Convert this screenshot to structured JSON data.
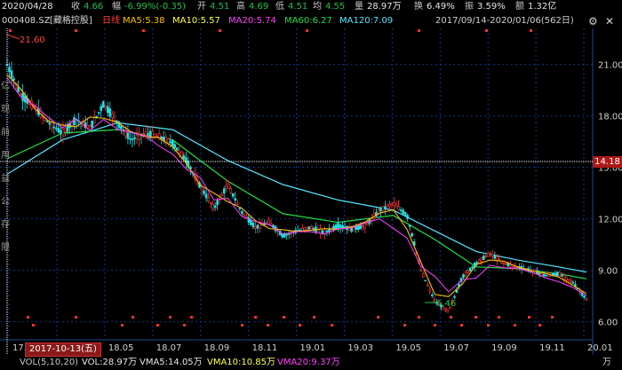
{
  "header": {
    "date": "2020/04/28",
    "close_label": "收",
    "close": "4.66",
    "change_label": "幅",
    "change": "-6.99%(-0.35)",
    "open_label": "开",
    "open": "4.51",
    "high_label": "高",
    "high": "4.69",
    "low_label": "低",
    "low": "4.51",
    "avg_label": "均",
    "avg": "4.55",
    "volume_label": "量",
    "volume": "28.97万",
    "turnover_label": "换",
    "turnover": "6.49%",
    "amplitude_label": "振",
    "amplitude": "3.59%",
    "amount_label": "额",
    "amount": "1.32亿"
  },
  "indicators": {
    "code": "000408.SZ",
    "name": "[藏格控股]",
    "period": "日线",
    "ma5": "MA5:5.38",
    "ma10": "MA10:5.57",
    "ma20": "MA20:5.74",
    "ma60": "MA60:6.27",
    "ma120": "MA120:7.09",
    "range": "2017/09/14-2020/01/06(562日)"
  },
  "colors": {
    "up": "#ff3b3b",
    "down": "#22e0e0",
    "ma5": "#ffc000",
    "ma10": "#ffff44",
    "ma20": "#ff40ff",
    "ma60": "#22dd44",
    "ma120": "#55e6ff",
    "grid": "#0a3a7a",
    "flag": "#ff3030"
  },
  "crosshair": {
    "value": "14.18",
    "date_label": "2017-10-13(五)"
  },
  "annotations": {
    "high": "21.60",
    "low": "6.46"
  },
  "volume_panel": {
    "label": "VOL(5,10,20)",
    "vol": "VOL:28.97万",
    "vma5": "VMA5:14.05万",
    "vma10": "VMA10:10.85万",
    "vma20": "VMA20:9.37万",
    "unit": "万"
  },
  "side_text": [
    "亿",
    "现",
    "前",
    "用",
    "益",
    "公",
    "存",
    "限"
  ],
  "chart_data": {
    "type": "candlestick",
    "x_range": [
      "2017-09-14",
      "2020-01-06"
    ],
    "x_ticks": [
      "17.",
      "18.03",
      "18.05",
      "18.07",
      "18.09",
      "18.11",
      "19.01",
      "19.03",
      "19.05",
      "19.07",
      "19.09",
      "19.11",
      "20.01"
    ],
    "y_ticks": [
      6.0,
      9.0,
      12.0,
      15.0,
      18.0,
      21.0
    ],
    "y_tick_labels": [
      "6.00",
      "9.00",
      "12.00",
      "15.00",
      "18.00",
      "21.00"
    ],
    "ylim": [
      5.0,
      23.0
    ],
    "close_path": [
      [
        0,
        21.0
      ],
      [
        1,
        19.2
      ],
      [
        2,
        18.5
      ],
      [
        3,
        17.6
      ],
      [
        4,
        17.0
      ],
      [
        5,
        17.8
      ],
      [
        6,
        17.3
      ],
      [
        7,
        18.7
      ],
      [
        8,
        17.6
      ],
      [
        9,
        16.6
      ],
      [
        10,
        17.0
      ],
      [
        11,
        16.8
      ],
      [
        12,
        16.4
      ],
      [
        13,
        15.4
      ],
      [
        14,
        13.9
      ],
      [
        15,
        12.6
      ],
      [
        16,
        14.0
      ],
      [
        17,
        12.4
      ],
      [
        18,
        11.5
      ],
      [
        19,
        11.8
      ],
      [
        20,
        11.0
      ],
      [
        21,
        11.3
      ],
      [
        22,
        11.5
      ],
      [
        23,
        11.2
      ],
      [
        24,
        11.6
      ],
      [
        25,
        11.4
      ],
      [
        26,
        11.6
      ],
      [
        27,
        12.5
      ],
      [
        28,
        12.9
      ],
      [
        29,
        12.2
      ],
      [
        30,
        9.0
      ],
      [
        31,
        7.2
      ],
      [
        32,
        6.6
      ],
      [
        33,
        8.6
      ],
      [
        34,
        9.4
      ],
      [
        35,
        10.0
      ],
      [
        36,
        9.4
      ],
      [
        37,
        9.2
      ],
      [
        38,
        9.0
      ],
      [
        39,
        8.7
      ],
      [
        40,
        8.8
      ],
      [
        41,
        8.3
      ],
      [
        42,
        7.3
      ]
    ],
    "ma120_path": [
      [
        0,
        14.6
      ],
      [
        4,
        16.6
      ],
      [
        8,
        17.6
      ],
      [
        12,
        17.2
      ],
      [
        16,
        15.4
      ],
      [
        20,
        14.0
      ],
      [
        24,
        13.1
      ],
      [
        28,
        12.5
      ],
      [
        31,
        11.3
      ],
      [
        34,
        10.1
      ],
      [
        37,
        9.6
      ],
      [
        40,
        9.2
      ],
      [
        42,
        8.9
      ]
    ],
    "ma60_path": [
      [
        0,
        15.5
      ],
      [
        4,
        17.0
      ],
      [
        8,
        17.2
      ],
      [
        12,
        16.6
      ],
      [
        16,
        14.2
      ],
      [
        20,
        12.3
      ],
      [
        24,
        11.8
      ],
      [
        28,
        12.2
      ],
      [
        31,
        10.8
      ],
      [
        34,
        9.2
      ],
      [
        37,
        9.1
      ],
      [
        40,
        8.8
      ],
      [
        42,
        8.5
      ]
    ],
    "series_names": [
      "MA5",
      "MA10",
      "MA20",
      "MA60",
      "MA120"
    ]
  }
}
